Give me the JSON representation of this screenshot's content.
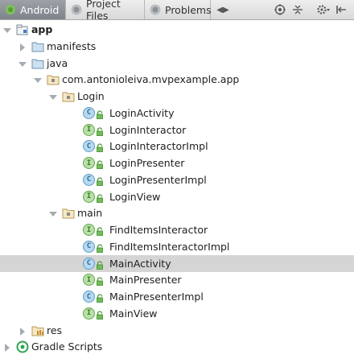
{
  "tabs": [
    {
      "label": "Android",
      "active": true,
      "icon": "android-icon"
    },
    {
      "label": "Project Files",
      "active": false,
      "icon": "project-files-icon"
    },
    {
      "label": "Problems",
      "active": false,
      "icon": "problems-icon"
    }
  ],
  "toolbar": {
    "scroll_arrows": "◀▶",
    "icons": [
      "target-icon",
      "collapse-all-icon",
      "settings-gear-icon",
      "hide-panel-icon"
    ]
  },
  "colors": {
    "class_badge": "#5c9bc7",
    "interface_badge": "#62a84b",
    "selection": "#d5d5d5",
    "active_tab": "#8a9096"
  },
  "tree": [
    {
      "label": "app",
      "kind": "module",
      "expanded": true,
      "bold": true
    },
    {
      "label": "manifests",
      "kind": "folder",
      "expanded": false
    },
    {
      "label": "java",
      "kind": "folder",
      "expanded": true
    },
    {
      "label": "com.antonioleiva.mvpexample.app",
      "kind": "package",
      "expanded": true
    },
    {
      "label": "Login",
      "kind": "package",
      "expanded": true
    },
    {
      "label": "LoginActivity",
      "kind": "class",
      "badge": "C"
    },
    {
      "label": "LoginInteractor",
      "kind": "interface",
      "badge": "I"
    },
    {
      "label": "LoginInteractorImpl",
      "kind": "class",
      "badge": "C"
    },
    {
      "label": "LoginPresenter",
      "kind": "interface",
      "badge": "I"
    },
    {
      "label": "LoginPresenterImpl",
      "kind": "class",
      "badge": "C"
    },
    {
      "label": "LoginView",
      "kind": "interface",
      "badge": "I"
    },
    {
      "label": "main",
      "kind": "package",
      "expanded": true
    },
    {
      "label": "FindItemsInteractor",
      "kind": "interface",
      "badge": "I"
    },
    {
      "label": "FindItemsInteractorImpl",
      "kind": "class",
      "badge": "C"
    },
    {
      "label": "MainActivity",
      "kind": "class",
      "badge": "C",
      "selected": true
    },
    {
      "label": "MainPresenter",
      "kind": "interface",
      "badge": "I"
    },
    {
      "label": "MainPresenterImpl",
      "kind": "class",
      "badge": "C"
    },
    {
      "label": "MainView",
      "kind": "interface",
      "badge": "I"
    },
    {
      "label": "res",
      "kind": "res-folder",
      "expanded": false
    },
    {
      "label": "Gradle Scripts",
      "kind": "gradle",
      "expanded": false
    }
  ]
}
